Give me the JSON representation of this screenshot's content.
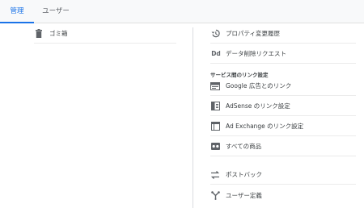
{
  "tabs": [
    {
      "label": "管理",
      "active": true
    },
    {
      "label": "ユーザー",
      "active": false
    }
  ],
  "left": {
    "items": [
      {
        "label": "ゴミ箱",
        "icon": "trash-icon"
      }
    ]
  },
  "right": {
    "items": [
      {
        "label": "プロパティ変更履歴",
        "icon": "history-icon"
      },
      {
        "label": "データ削除リクエスト",
        "icon": "dd-icon"
      }
    ],
    "section_title": "サービス間のリンク設定",
    "link_items": [
      {
        "label": "Google 広告とのリンク",
        "icon": "google-ads-icon"
      },
      {
        "label": "AdSense のリンク設定",
        "icon": "adsense-icon"
      },
      {
        "label": "Ad Exchange のリンク設定",
        "icon": "ad-exchange-icon"
      },
      {
        "label": "すべての商品",
        "icon": "all-products-icon"
      }
    ],
    "bottom_items": [
      {
        "label": "ポストバック",
        "icon": "postback-icon"
      },
      {
        "label": "ユーザー定義",
        "icon": "custom-definitions-icon"
      }
    ]
  },
  "colors": {
    "accent": "#1a73e8",
    "text": "#3c4043",
    "icon": "#5f6368"
  },
  "icon_text": {
    "dd": "Dd"
  }
}
